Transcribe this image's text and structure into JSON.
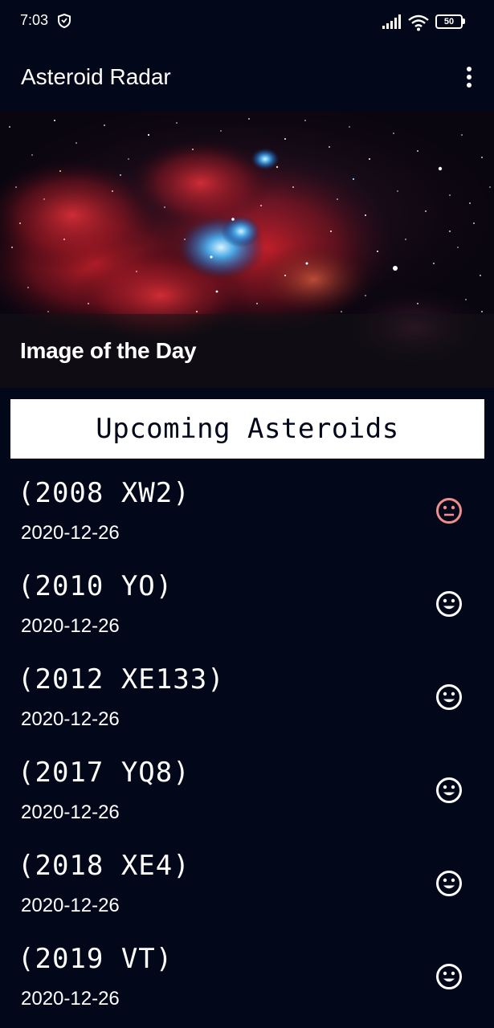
{
  "status_bar": {
    "time": "7:03",
    "battery": "50",
    "icons": [
      "shield-icon",
      "signal-icon",
      "wifi-icon",
      "battery-icon"
    ]
  },
  "app_bar": {
    "title": "Asteroid Radar",
    "menu_icon": "more-vertical-icon"
  },
  "image_of_day": {
    "caption": "Image of the Day"
  },
  "section": {
    "title": "Upcoming Asteroids"
  },
  "asteroids": [
    {
      "name": "(2008 XW2)",
      "date": "2020-12-26",
      "status_icon": "neutral-face-icon",
      "hazardous": true
    },
    {
      "name": "(2010 YO)",
      "date": "2020-12-26",
      "status_icon": "smiley-face-icon",
      "hazardous": false
    },
    {
      "name": "(2012 XE133)",
      "date": "2020-12-26",
      "status_icon": "smiley-face-icon",
      "hazardous": false
    },
    {
      "name": "(2017 YQ8)",
      "date": "2020-12-26",
      "status_icon": "smiley-face-icon",
      "hazardous": false
    },
    {
      "name": "(2018 XE4)",
      "date": "2020-12-26",
      "status_icon": "smiley-face-icon",
      "hazardous": false
    },
    {
      "name": "(2019 VT)",
      "date": "2020-12-26",
      "status_icon": "smiley-face-icon",
      "hazardous": false
    }
  ],
  "colors": {
    "background": "#03071a",
    "hazardous": "#f08d8d",
    "safe": "#ffffff"
  }
}
